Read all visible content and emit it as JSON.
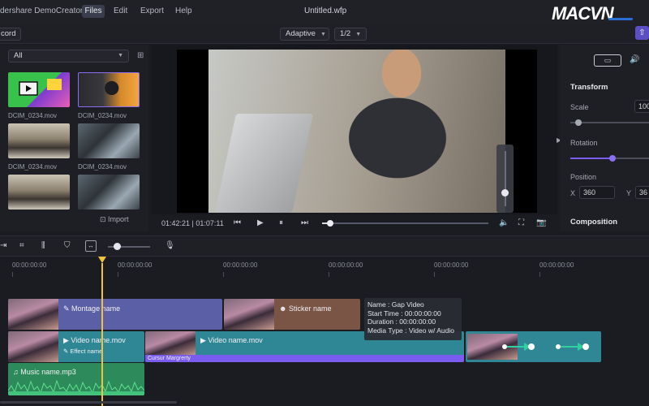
{
  "menubar": {
    "app_title": "dershare DemoCreator",
    "files": "Files",
    "edit": "Edit",
    "export": "Export",
    "help": "Help",
    "doc_title": "Untitled.wfp",
    "watermark": "MACVN"
  },
  "toolbar": {
    "record": "cord",
    "zoom_mode": "Adaptive",
    "quality": "1/2"
  },
  "media": {
    "filter": "All",
    "items": [
      {
        "label": "DCIM_0234.mov"
      },
      {
        "label": "DCIM_0234.mov"
      },
      {
        "label": "DCIM_0234.mov"
      },
      {
        "label": "DCIM_0234.mov"
      },
      {
        "label": ""
      },
      {
        "label": ""
      }
    ],
    "import": "Import"
  },
  "player": {
    "time": "01:42:21 | 01:07:11",
    "progress": 0.05,
    "volume": 0.25
  },
  "props": {
    "transform": "Transform",
    "scale": "Scale",
    "scale_value": "100",
    "rotation": "Rotation",
    "position": "Position",
    "x_label": "X",
    "x_value": "360",
    "y_label": "Y",
    "y_value": "36",
    "composition": "Composition"
  },
  "timeline": {
    "ruler": [
      "00:00:00:00",
      "00:00:00:00",
      "00:00:00:00",
      "00:00:00:00",
      "00:00:00:00",
      "00:00:00:00"
    ],
    "clips": {
      "montage": "Montage name",
      "sticker": "Sticker name",
      "video1": "Video name.mov",
      "effect": "Effect name",
      "video2": "Video name.mov",
      "cursor": "Cursur Margrerty",
      "music": "Music name.mp3"
    },
    "tooltip": {
      "name": "Name : Gap Video",
      "start": "Start Time : 00:00:00:00",
      "duration": "Duration : 00:00:00:00",
      "media": "Media Type : Video w/ Audio"
    }
  },
  "colors": {
    "accent_purple": "#7b5cf0",
    "track_blue": "#5a5fa6",
    "track_teal": "#2f8795",
    "track_brown": "#7a5545",
    "track_green": "#2d8a5a",
    "playhead": "#f2c23c"
  }
}
